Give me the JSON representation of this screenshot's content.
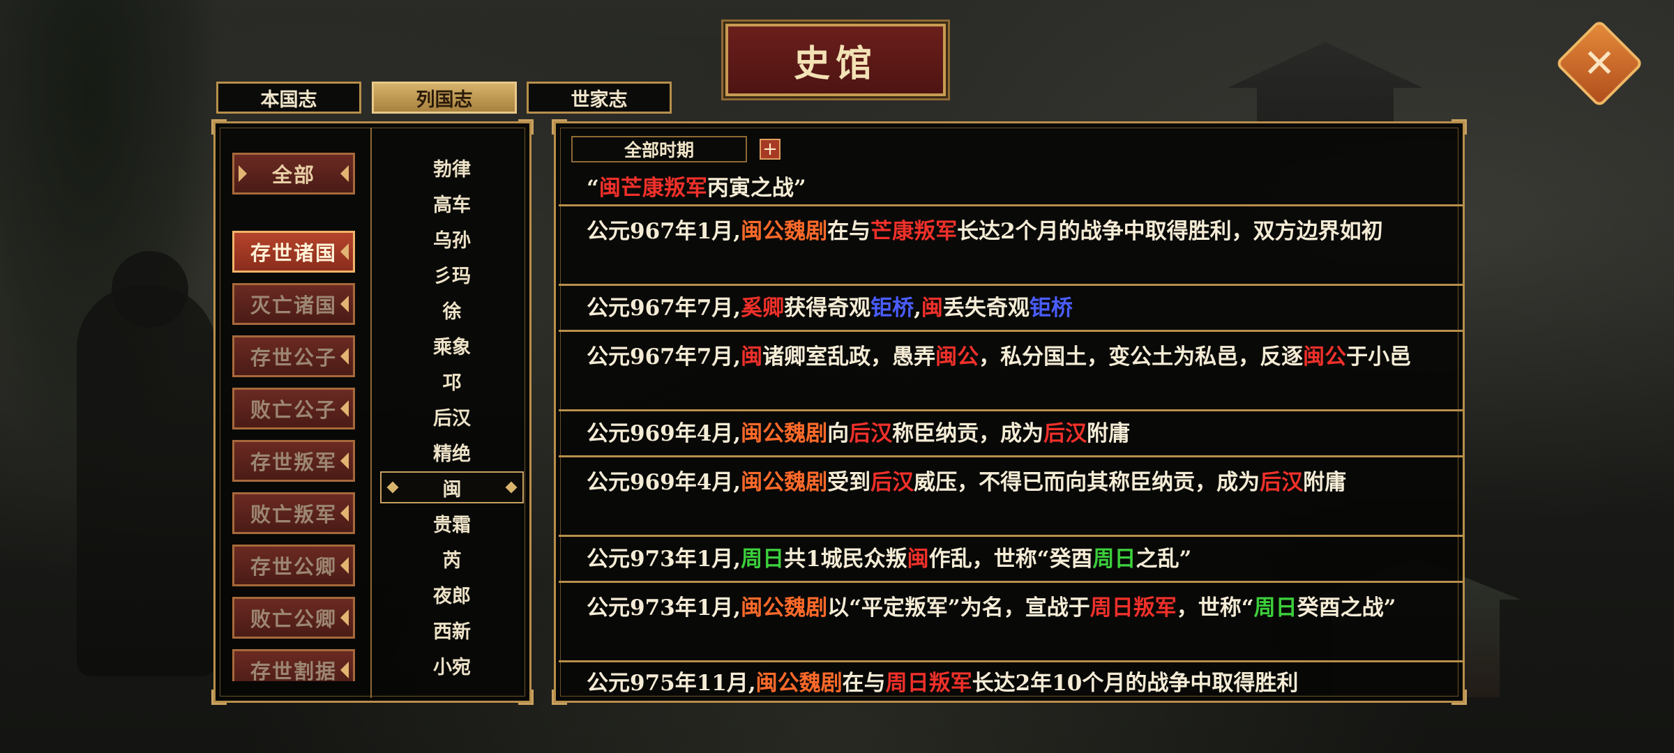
{
  "title": "史馆",
  "tabs": [
    {
      "label": "本国志"
    },
    {
      "label": "列国志"
    },
    {
      "label": "世家志"
    }
  ],
  "categories": [
    {
      "label": "全部"
    },
    {
      "label": "存世诸国"
    },
    {
      "label": "灭亡诸国"
    },
    {
      "label": "存世公子"
    },
    {
      "label": "败亡公子"
    },
    {
      "label": "存世叛军"
    },
    {
      "label": "败亡叛军"
    },
    {
      "label": "存世公卿"
    },
    {
      "label": "败亡公卿"
    },
    {
      "label": "存世割据"
    }
  ],
  "states": [
    {
      "label": "勃律"
    },
    {
      "label": "高车"
    },
    {
      "label": "乌孙"
    },
    {
      "label": "彡玛"
    },
    {
      "label": "徐"
    },
    {
      "label": "乘象"
    },
    {
      "label": "邛"
    },
    {
      "label": "后汉"
    },
    {
      "label": "精绝"
    },
    {
      "label": "闽"
    },
    {
      "label": "贵霜"
    },
    {
      "label": "芮"
    },
    {
      "label": "夜郎"
    },
    {
      "label": "西新"
    },
    {
      "label": "小宛"
    }
  ],
  "selected_state": "闽",
  "period_filter": "全部时期",
  "plus_label": "+",
  "colors": {
    "state_red": "#f0302a",
    "person_orange": "#ff6a2a",
    "wonder_blue": "#4a5dff",
    "rebel_green": "#3ccf3c",
    "frame_gold": "#b88f4b"
  },
  "records": [
    {
      "segments": [
        {
          "t": "“",
          "c": ""
        },
        {
          "t": "闽芒康叛军",
          "c": "r"
        },
        {
          "t": "丙寅之战”",
          "c": ""
        }
      ]
    },
    {
      "segments": [
        {
          "t": "公元967年1月,",
          "c": ""
        },
        {
          "t": "闽公魏剧",
          "c": "o"
        },
        {
          "t": "在与",
          "c": ""
        },
        {
          "t": "芒康叛军",
          "c": "r"
        },
        {
          "t": "长达2个月的战争中取得胜利，双方边界如初",
          "c": ""
        }
      ]
    },
    {
      "segments": [
        {
          "t": "公元967年7月,",
          "c": ""
        },
        {
          "t": "奚卿",
          "c": "r"
        },
        {
          "t": "获得奇观",
          "c": ""
        },
        {
          "t": "钜桥",
          "c": "b"
        },
        {
          "t": ",",
          "c": ""
        },
        {
          "t": "闽",
          "c": "r"
        },
        {
          "t": "丢失奇观",
          "c": ""
        },
        {
          "t": "钜桥",
          "c": "b"
        }
      ]
    },
    {
      "segments": [
        {
          "t": "公元967年7月,",
          "c": ""
        },
        {
          "t": "闽",
          "c": "r"
        },
        {
          "t": "诸卿室乱政，愚弄",
          "c": ""
        },
        {
          "t": "闽公",
          "c": "r"
        },
        {
          "t": "，私分国土，变公土为私邑，反逐",
          "c": ""
        },
        {
          "t": "闽公",
          "c": "r"
        },
        {
          "t": "于小邑",
          "c": ""
        }
      ]
    },
    {
      "segments": [
        {
          "t": "公元969年4月,",
          "c": ""
        },
        {
          "t": "闽公魏剧",
          "c": "o"
        },
        {
          "t": "向",
          "c": ""
        },
        {
          "t": "后汉",
          "c": "r"
        },
        {
          "t": "称臣纳贡，成为",
          "c": ""
        },
        {
          "t": "后汉",
          "c": "r"
        },
        {
          "t": "附庸",
          "c": ""
        }
      ]
    },
    {
      "segments": [
        {
          "t": "公元969年4月,",
          "c": ""
        },
        {
          "t": "闽公魏剧",
          "c": "o"
        },
        {
          "t": "受到",
          "c": ""
        },
        {
          "t": "后汉",
          "c": "r"
        },
        {
          "t": "威压，不得已而向其称臣纳贡，成为",
          "c": ""
        },
        {
          "t": "后汉",
          "c": "r"
        },
        {
          "t": "附庸",
          "c": ""
        }
      ]
    },
    {
      "segments": [
        {
          "t": "公元973年1月,",
          "c": ""
        },
        {
          "t": "周日",
          "c": "g"
        },
        {
          "t": "共1城民众叛",
          "c": ""
        },
        {
          "t": "闽",
          "c": "r"
        },
        {
          "t": "作乱，世称“癸酉",
          "c": ""
        },
        {
          "t": "周日",
          "c": "g"
        },
        {
          "t": "之乱”",
          "c": ""
        }
      ]
    },
    {
      "segments": [
        {
          "t": "公元973年1月,",
          "c": ""
        },
        {
          "t": "闽公魏剧",
          "c": "o"
        },
        {
          "t": "以“平定叛军”为名，宣战于",
          "c": ""
        },
        {
          "t": "周日叛军",
          "c": "r"
        },
        {
          "t": "，世称“",
          "c": ""
        },
        {
          "t": "周日",
          "c": "g"
        },
        {
          "t": "癸酉之战”",
          "c": ""
        }
      ]
    },
    {
      "segments": [
        {
          "t": "公元975年11月,",
          "c": ""
        },
        {
          "t": "闽公魏剧",
          "c": "o"
        },
        {
          "t": "在与",
          "c": ""
        },
        {
          "t": "周日叛军",
          "c": "r"
        },
        {
          "t": "长达2年10个月的战争中取得胜利",
          "c": ""
        }
      ]
    }
  ]
}
